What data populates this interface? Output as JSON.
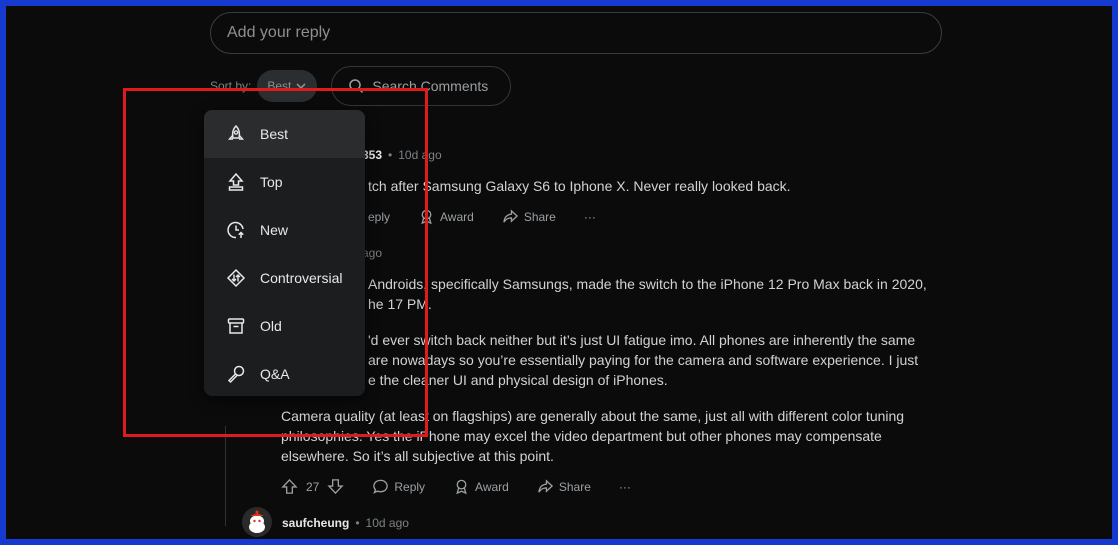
{
  "reply": {
    "placeholder": "Add your reply"
  },
  "sort": {
    "label": "Sort by:",
    "current": "Best",
    "search_label": "Search Comments"
  },
  "menu": {
    "items": [
      {
        "label": "Best",
        "icon": "rocket-icon"
      },
      {
        "label": "Top",
        "icon": "top-arrow-icon"
      },
      {
        "label": "New",
        "icon": "clock-up-icon"
      },
      {
        "label": "Controversial",
        "icon": "controversial-icon"
      },
      {
        "label": "Old",
        "icon": "archive-icon"
      },
      {
        "label": "Q&A",
        "icon": "microphone-icon"
      }
    ]
  },
  "comments": [
    {
      "author_fragment": "353",
      "time": "10d ago",
      "text": "tch after Samsung Galaxy S6 to Iphone X. Never really looked back.",
      "reply_label": "eply",
      "award_label": "Award",
      "share_label": "Share",
      "more_label": "···"
    },
    {
      "time": "ago",
      "paragraphs": [
        "Androids, specifically Samsungs, made the switch to the iPhone 12 Pro Max back in 2020,",
        "he 17 PM.",
        "'d ever switch back neither but it’s just UI fatigue imo. All phones are inherently the same",
        "are nowadays so you’re essentially paying for the camera and software experience. I just",
        "e the cleaner UI and physical design of iPhones.",
        "Camera quality (at least on flagships) are generally about the same, just all with different color tuning",
        "philosophies. Yes the iPhone may excel the video department but other phones may compensate",
        "elsewhere. So it’s all subjective at this point."
      ],
      "votes": "27",
      "reply_label": "Reply",
      "award_label": "Award",
      "share_label": "Share",
      "more_label": "···"
    },
    {
      "author": "saufcheung",
      "time": "10d ago"
    }
  ],
  "separator": "•",
  "colors": {
    "highlight": "#e11b1b",
    "frame": "#1639cf",
    "background": "#0b0b0b"
  }
}
